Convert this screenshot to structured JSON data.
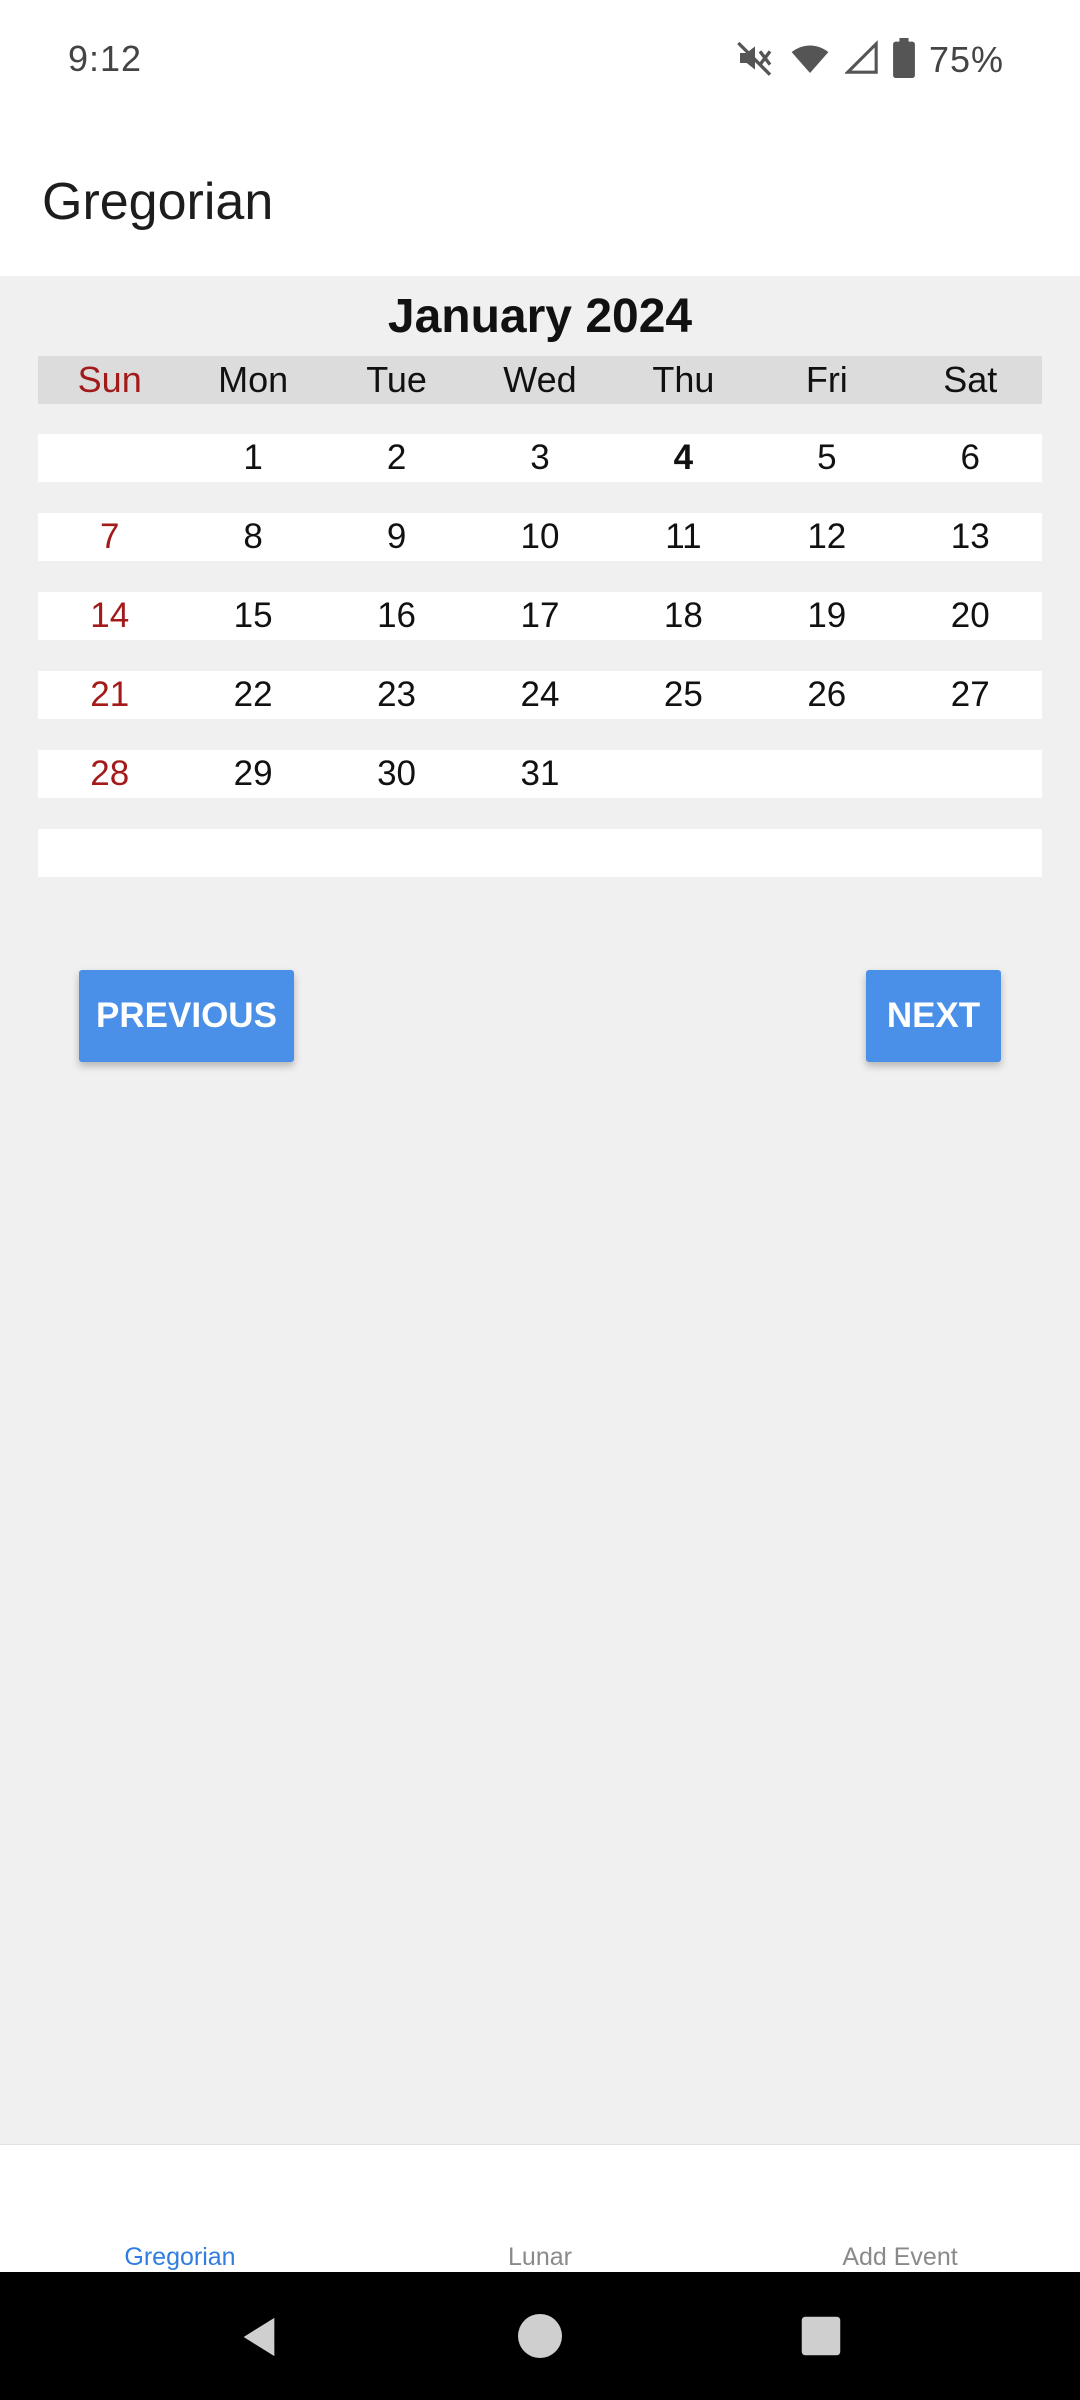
{
  "status_bar": {
    "time": "9:12",
    "battery": "75%",
    "icons": [
      "mute-icon",
      "wifi-icon",
      "signal-icon",
      "battery-icon"
    ]
  },
  "app_bar": {
    "title": "Gregorian"
  },
  "calendar": {
    "month_title": "January 2024",
    "weekdays": [
      "Sun",
      "Mon",
      "Tue",
      "Wed",
      "Thu",
      "Fri",
      "Sat"
    ],
    "weeks": [
      [
        "",
        "1",
        "2",
        "3",
        "4",
        "5",
        "6"
      ],
      [
        "7",
        "8",
        "9",
        "10",
        "11",
        "12",
        "13"
      ],
      [
        "14",
        "15",
        "16",
        "17",
        "18",
        "19",
        "20"
      ],
      [
        "21",
        "22",
        "23",
        "24",
        "25",
        "26",
        "27"
      ],
      [
        "28",
        "29",
        "30",
        "31",
        "",
        "",
        ""
      ],
      [
        "",
        "",
        "",
        "",
        "",
        "",
        ""
      ]
    ],
    "today": "4"
  },
  "buttons": {
    "previous": "PREVIOUS",
    "next": "NEXT"
  },
  "bottom_nav": {
    "items": [
      {
        "label": "Gregorian",
        "active": true
      },
      {
        "label": "Lunar",
        "active": false
      },
      {
        "label": "Add Event",
        "active": false
      }
    ]
  },
  "colors": {
    "accent": "#4a90e8",
    "active_tab": "#2f7de1",
    "sunday": "#a31a1a",
    "background": "#f0f0f0"
  },
  "system_nav": [
    "back-icon",
    "home-icon",
    "recents-icon"
  ]
}
